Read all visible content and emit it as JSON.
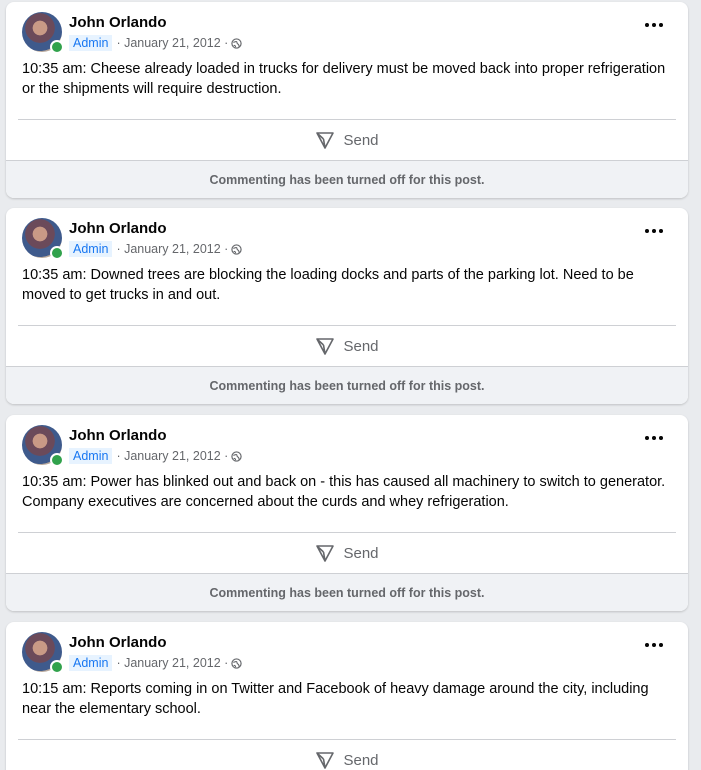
{
  "posts": [
    {
      "author": "John Orlando",
      "role": "Admin",
      "date": "· January 21, 2012 ·",
      "visibility_icon": "globe-icon",
      "text": "10:35 am:  Cheese already loaded in trucks for delivery must be moved back into proper refrigeration or the shipments will require destruction.",
      "send_label": "Send",
      "comment_status": "Commenting has been turned off for this post."
    },
    {
      "author": "John Orlando",
      "role": "Admin",
      "date": "· January 21, 2012 ·",
      "visibility_icon": "globe-icon",
      "text": "10:35 am: Downed trees are blocking the loading docks and parts of the parking lot.  Need to be moved to get trucks in and out.",
      "send_label": "Send",
      "comment_status": "Commenting has been turned off for this post."
    },
    {
      "author": "John Orlando",
      "role": "Admin",
      "date": "· January 21, 2012 ·",
      "visibility_icon": "globe-icon",
      "text": "10:35 am:  Power has blinked out and back on - this has caused all machinery to switch to generator. Company executives are concerned about the curds and whey refrigeration.",
      "send_label": "Send",
      "comment_status": "Commenting has been turned off for this post."
    },
    {
      "author": "John Orlando",
      "role": "Admin",
      "date": "· January 21, 2012 ·",
      "visibility_icon": "globe-icon",
      "text": "10:15 am: Reports coming in on Twitter and Facebook of heavy damage around the city, including near the elementary school.",
      "send_label": "Send"
    }
  ],
  "colors": {
    "online": "#31a24c",
    "admin_badge_bg": "#e7f3ff",
    "admin_badge_text": "#1877f2",
    "feed_bg": "#e9ebee"
  }
}
